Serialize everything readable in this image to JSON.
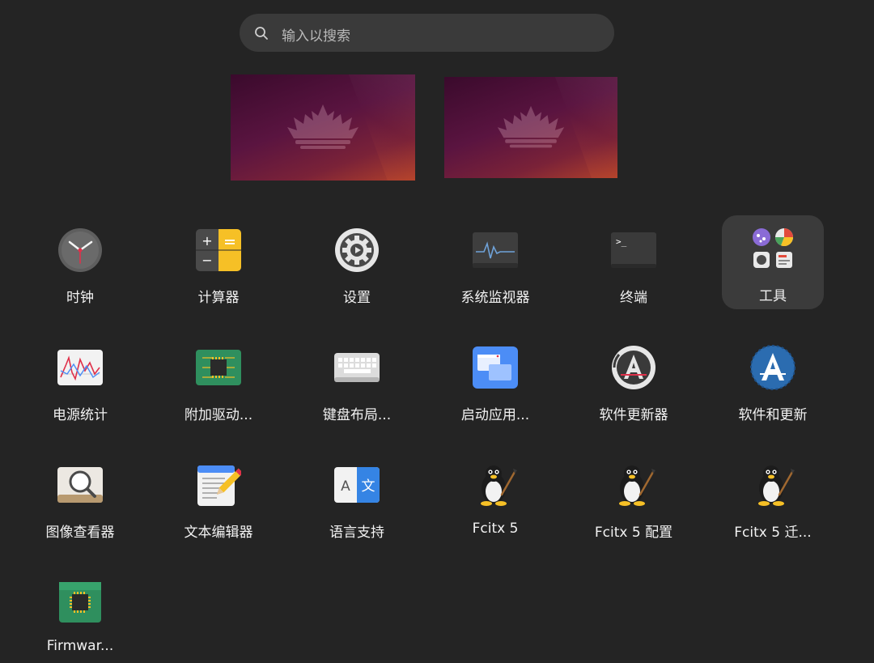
{
  "search": {
    "placeholder": "输入以搜索"
  },
  "apps": [
    {
      "id": "clock",
      "label": "时钟"
    },
    {
      "id": "calculator",
      "label": "计算器"
    },
    {
      "id": "settings",
      "label": "设置"
    },
    {
      "id": "system-monitor",
      "label": "系统监视器"
    },
    {
      "id": "terminal",
      "label": "终端"
    },
    {
      "id": "utilities-folder",
      "label": "工具",
      "selected": true
    },
    {
      "id": "power-statistics",
      "label": "电源统计"
    },
    {
      "id": "additional-drivers",
      "label": "附加驱动..."
    },
    {
      "id": "keyboard-layout",
      "label": "键盘布局..."
    },
    {
      "id": "startup-apps",
      "label": "启动应用..."
    },
    {
      "id": "software-updater",
      "label": "软件更新器"
    },
    {
      "id": "software-and-updates",
      "label": "软件和更新"
    },
    {
      "id": "image-viewer",
      "label": "图像查看器"
    },
    {
      "id": "text-editor",
      "label": "文本编辑器"
    },
    {
      "id": "language-support",
      "label": "语言支持"
    },
    {
      "id": "fcitx5",
      "label": "Fcitx 5"
    },
    {
      "id": "fcitx5-config",
      "label": "Fcitx 5 配置"
    },
    {
      "id": "fcitx5-migrator",
      "label": "Fcitx 5 迁..."
    },
    {
      "id": "firmware",
      "label": "Firmwar..."
    }
  ],
  "icons": {
    "terminal_prompt": ">_",
    "language_a": "A",
    "language_wen": "文"
  },
  "colors": {
    "background": "#242424",
    "search_bg": "#3a3a3a",
    "selected_bg": "#3b3b3b",
    "calculator_yellow": "#f6c026",
    "startup_blue": "#4c8df6"
  }
}
